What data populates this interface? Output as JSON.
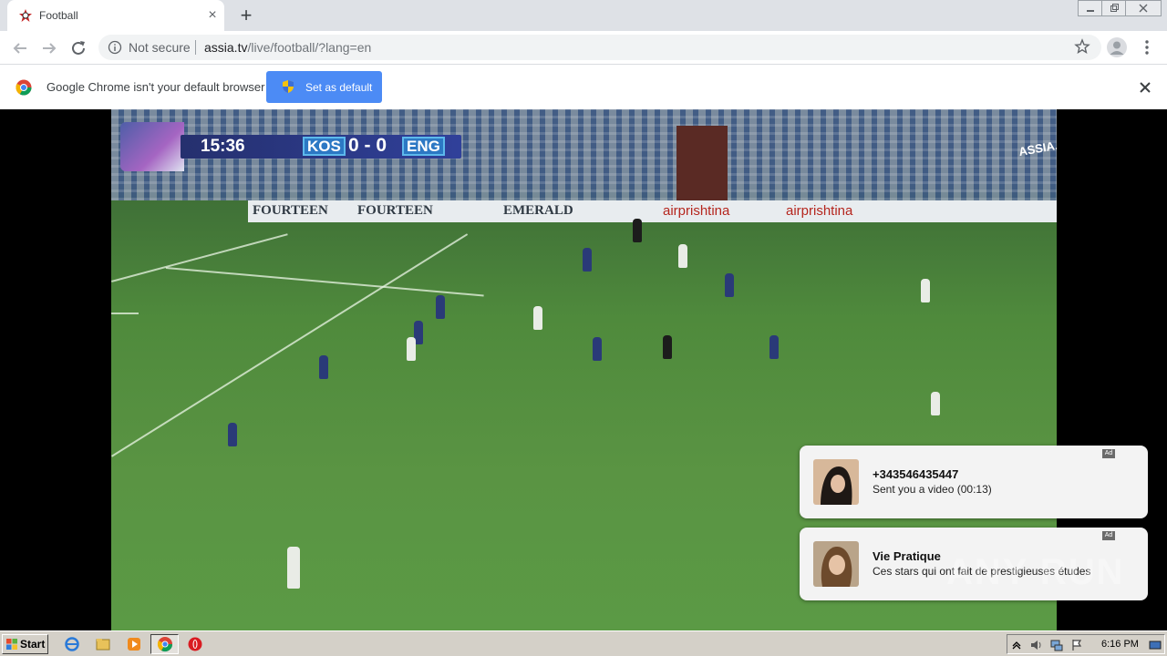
{
  "browser": {
    "tab_title": "Football",
    "new_tab_symbol": "+",
    "close_symbol": "×",
    "security_label": "Not secure",
    "url_host": "assia.tv",
    "url_path": "/live/football/?lang=en"
  },
  "infobar": {
    "message": "Google Chrome isn't your default browser",
    "button_label": "Set as default"
  },
  "video": {
    "scorebug": {
      "clock": "15:36",
      "home_team": "KOS",
      "score": "0 - 0",
      "away_team": "ENG"
    },
    "channel_logo": "ASSIA.TV",
    "ad_boards": [
      "FOURTEEN",
      "FOURTEEN",
      "EMERALD",
      "airprishtina",
      "airprishtina"
    ]
  },
  "notifications": [
    {
      "title": "+343546435447",
      "body": "Sent you a video (00:13)",
      "badge": "Ad"
    },
    {
      "title": "Vie Pratique",
      "body": "Ces stars qui ont fait de prestigieuses études",
      "badge": "Ad"
    }
  ],
  "watermark": "ANY RUN",
  "taskbar": {
    "start_label": "Start",
    "clock": "6:16 PM"
  },
  "colors": {
    "accent_blue": "#4c8bf5",
    "scorebug_navy": "#25306e",
    "pitch_green": "#5a9443"
  }
}
